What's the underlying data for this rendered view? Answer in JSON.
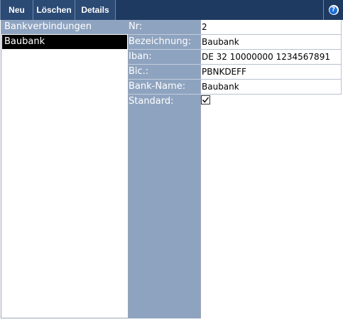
{
  "toolbar": {
    "new_label": "Neu",
    "delete_label": "Löschen",
    "details_label": "Details",
    "help_icon": "question-circle-icon",
    "help_glyph": "?"
  },
  "list": {
    "header": "Bankverbindungen",
    "items": [
      {
        "label": "Baubank",
        "selected": true
      }
    ]
  },
  "form": {
    "nr": {
      "label": "Nr:",
      "value": "2"
    },
    "bezeichnung": {
      "label": "Bezeichnung:",
      "value": "Baubank"
    },
    "iban": {
      "label": "Iban:",
      "value": "DE 32 10000000 1234567891"
    },
    "bic": {
      "label": "Bic.:",
      "value": "PBNKDEFF"
    },
    "bankname": {
      "label": "Bank-Name:",
      "value": "Baubank"
    },
    "standard": {
      "label": "Standard:",
      "checked": true
    }
  },
  "colors": {
    "toolbar_bg": "#1f3a60",
    "button_bg": "#2b4a74",
    "label_bg": "#8ea3bf",
    "selected_bg": "#000000",
    "help_blue": "#1f6fd6"
  }
}
